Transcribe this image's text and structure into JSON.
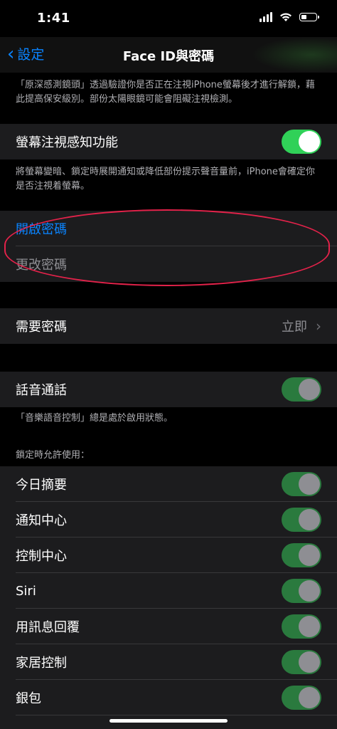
{
  "status": {
    "time": "1:41",
    "battery_level": 0.4
  },
  "nav": {
    "back_label": "設定",
    "title": "Face ID與密碼"
  },
  "attention_footer": "「原深感測鏡頭」透過驗證你是否正在注視iPhone螢幕後才進行解鎖，藉此提高保安級別。部份太陽眼鏡可能會阻礙注視檢測。",
  "attention_aware": {
    "label": "螢幕注視感知功能",
    "on": true
  },
  "attention_aware_footer": "將螢幕變暗、鎖定時展開通知或降低部份提示聲音量前，iPhone會確定你是否注視着螢幕。",
  "passcode": {
    "turn_on": "開啟密碼",
    "change": "更改密碼"
  },
  "require_passcode": {
    "label": "需要密碼",
    "value": "立即"
  },
  "voice_dial": {
    "label": "話音通話",
    "on": true
  },
  "voice_dial_footer": "「音樂語音控制」總是處於啟用狀態。",
  "lock_header": "鎖定時允許使用：",
  "lock_items": [
    {
      "label": "今日摘要",
      "on": true
    },
    {
      "label": "通知中心",
      "on": true
    },
    {
      "label": "控制中心",
      "on": true
    },
    {
      "label": "Siri",
      "on": true
    },
    {
      "label": "用訊息回覆",
      "on": true
    },
    {
      "label": "家居控制",
      "on": true
    },
    {
      "label": "銀包",
      "on": true
    }
  ],
  "colors": {
    "accent": "#0a84ff",
    "toggle_on": "#30d158",
    "annotation": "#e3224a"
  }
}
